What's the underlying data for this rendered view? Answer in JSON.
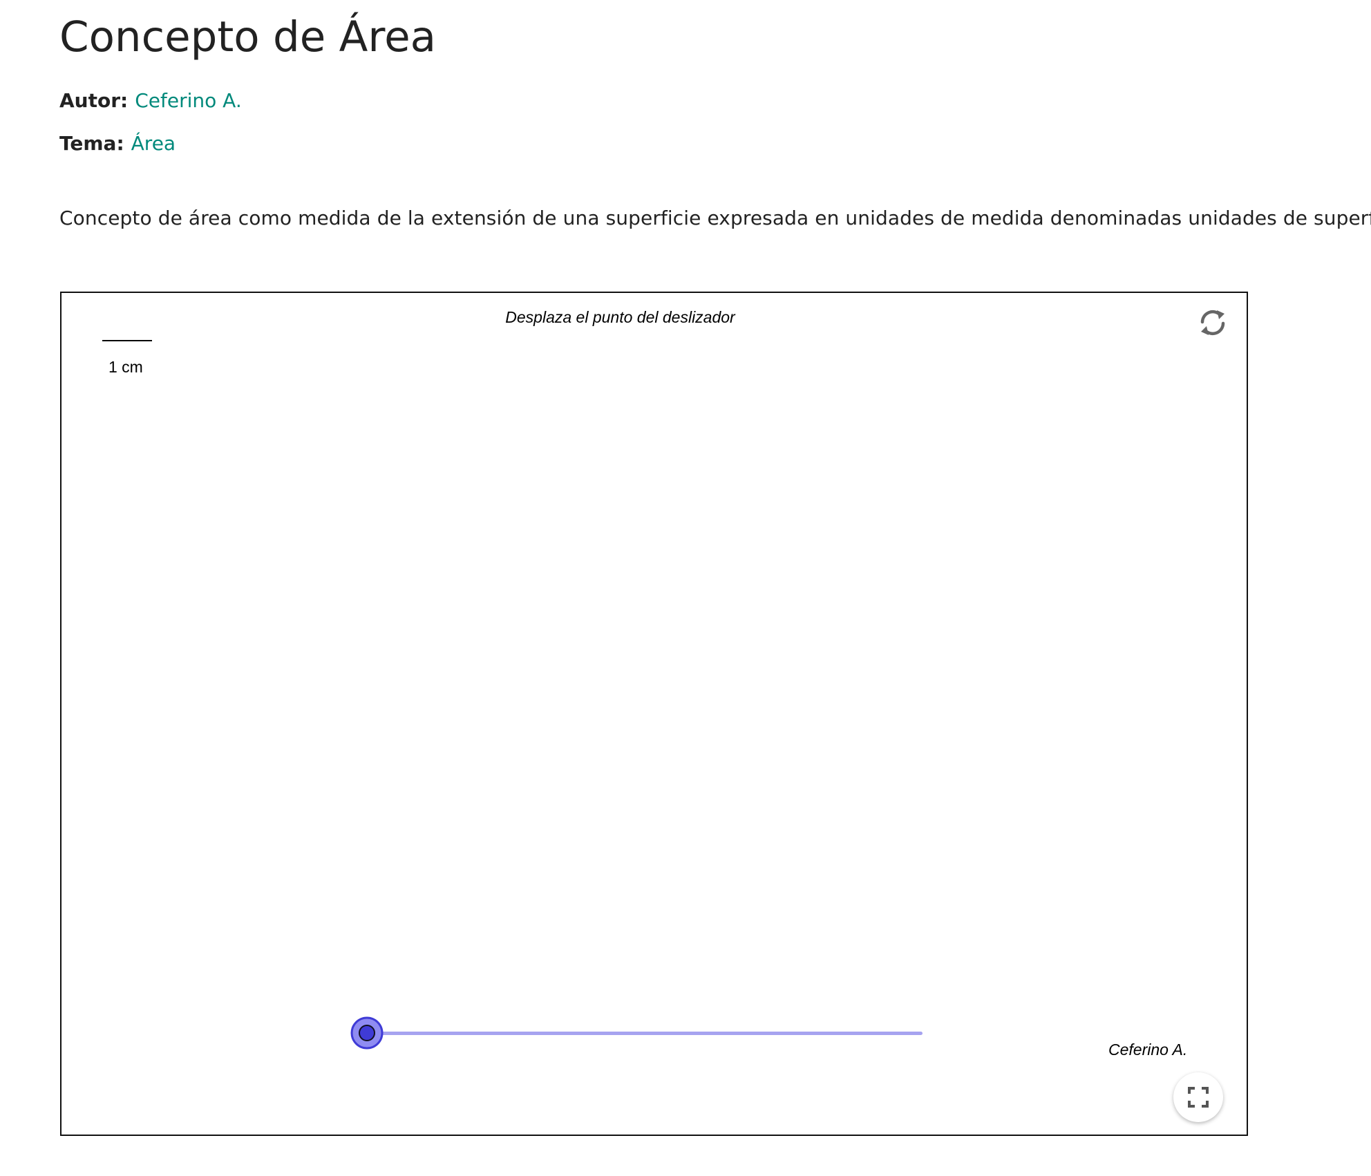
{
  "page": {
    "title": "Concepto de Área",
    "author_label": "Autor:",
    "author_name": "Ceferino A.",
    "topic_label": "Tema:",
    "topic_name": "Área",
    "description": "Concepto de área como medida de la extensión de una superficie expresada en unidades de medida denominadas unidades de superficie",
    "link_color": "#00897b"
  },
  "applet": {
    "instruction": "Desplaza el punto del deslizador",
    "scale_label": "1 cm",
    "author_caption": "Ceferino A.",
    "reset_icon": "refresh-icon",
    "fullscreen_icon": "fullscreen-icon",
    "slider": {
      "value_fraction": 0,
      "track_color": "#a6a3f0",
      "handle_color": "#4a46e8"
    }
  }
}
